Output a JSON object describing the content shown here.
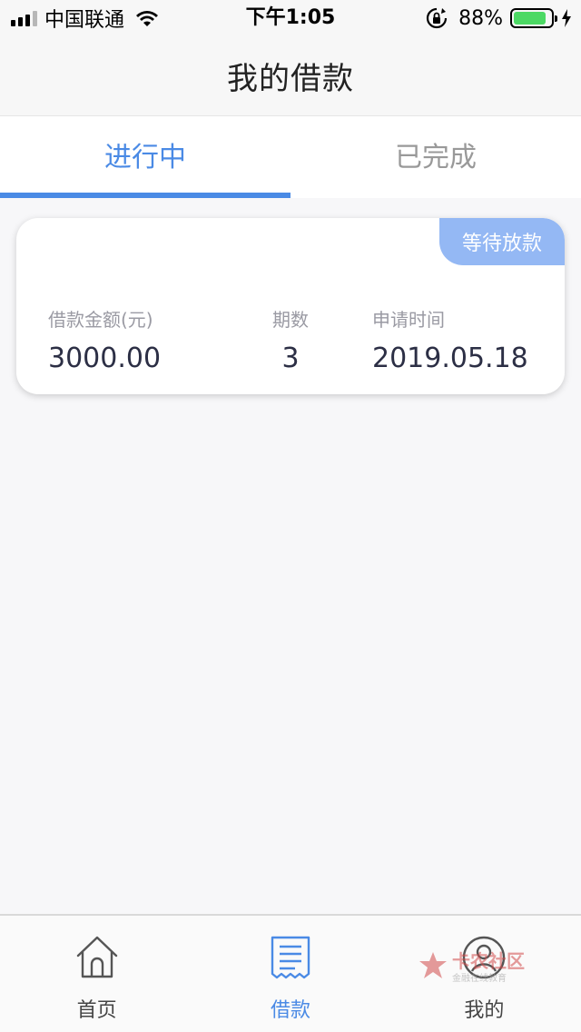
{
  "status_bar": {
    "carrier": "中国联通",
    "time": "下午1:05",
    "battery_percent": "88%",
    "battery_level": 0.88
  },
  "nav": {
    "title": "我的借款"
  },
  "tabs": [
    {
      "label": "进行中",
      "active": true
    },
    {
      "label": "已完成",
      "active": false
    }
  ],
  "loan_card": {
    "status": "等待放款",
    "amount_label": "借款金额(元)",
    "amount_value": "3000.00",
    "periods_label": "期数",
    "periods_value": "3",
    "date_label": "申请时间",
    "date_value": "2019.05.18"
  },
  "tab_bar": [
    {
      "label": "首页",
      "icon": "home-icon",
      "active": false
    },
    {
      "label": "借款",
      "icon": "document-icon",
      "active": true
    },
    {
      "label": "我的",
      "icon": "user-icon",
      "active": false
    }
  ],
  "watermark": {
    "title": "卡农社区",
    "subtitle": "金融在线教育"
  },
  "colors": {
    "accent": "#4a8ae5",
    "badge": "#94b8f4",
    "battery": "#4cd964"
  }
}
